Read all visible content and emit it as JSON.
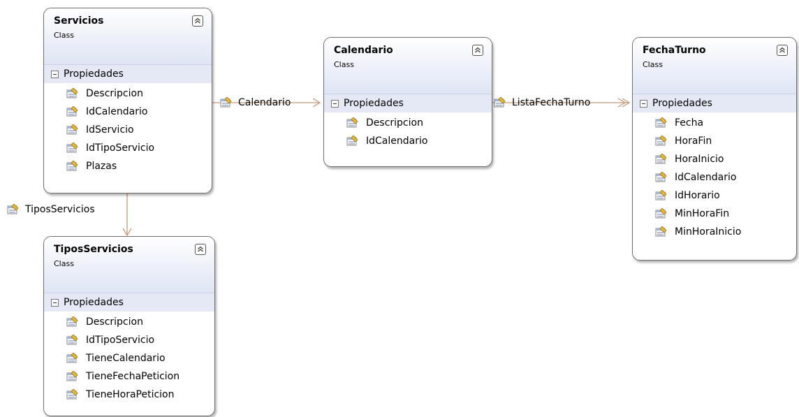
{
  "section_label": "Propiedades",
  "classes": [
    {
      "name": "Servicios",
      "kind": "Class",
      "properties": [
        "Descripcion",
        "IdCalendario",
        "IdServicio",
        "IdTipoServicio",
        "Plazas"
      ]
    },
    {
      "name": "Calendario",
      "kind": "Class",
      "properties": [
        "Descripcion",
        "IdCalendario"
      ]
    },
    {
      "name": "FechaTurno",
      "kind": "Class",
      "properties": [
        "Fecha",
        "HoraFin",
        "HoraInicio",
        "IdCalendario",
        "IdHorario",
        "MinHoraFin",
        "MinHoraInicio"
      ]
    },
    {
      "name": "TiposServicios",
      "kind": "Class",
      "properties": [
        "Descripcion",
        "IdTipoServicio",
        "TieneCalendario",
        "TieneFechaPeticion",
        "TieneHoraPeticion"
      ]
    }
  ],
  "associations": [
    {
      "from": "Servicios",
      "to": "Calendario",
      "label": "Calendario",
      "multiplicity": "single"
    },
    {
      "from": "Calendario",
      "to": "FechaTurno",
      "label": "ListaFechaTurno",
      "multiplicity": "collection"
    },
    {
      "from": "Servicios",
      "to": "TiposServicios",
      "label": "TiposServicios",
      "multiplicity": "single"
    }
  ],
  "colors": {
    "connector": "#c79a7a",
    "header_gradient_bottom": "#dfe5f5",
    "border": "#6e6e6e"
  }
}
